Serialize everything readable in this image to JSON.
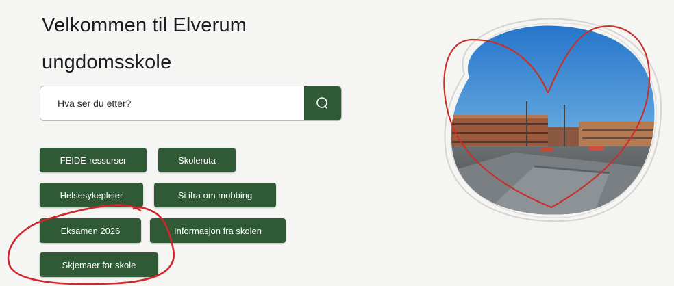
{
  "header": {
    "title_line1": "Velkommen til Elverum",
    "title_line2": "ungdomsskole"
  },
  "search": {
    "placeholder": "Hva ser du etter?",
    "icon": "search-icon"
  },
  "quick_links": [
    {
      "label": "FEIDE-ressurser"
    },
    {
      "label": "Skoleruta"
    },
    {
      "label": "Helsesykepleier"
    },
    {
      "label": "Si ifra om mobbing"
    },
    {
      "label": "Eksamen 2026"
    },
    {
      "label": "Informasjon fra skolen"
    },
    {
      "label": "Skjemaer for skole"
    }
  ],
  "colors": {
    "button_green": "#2f5a35",
    "background": "#f5f5f4",
    "annotation_red": "#d0262c",
    "heart_red": "#c8302a"
  }
}
